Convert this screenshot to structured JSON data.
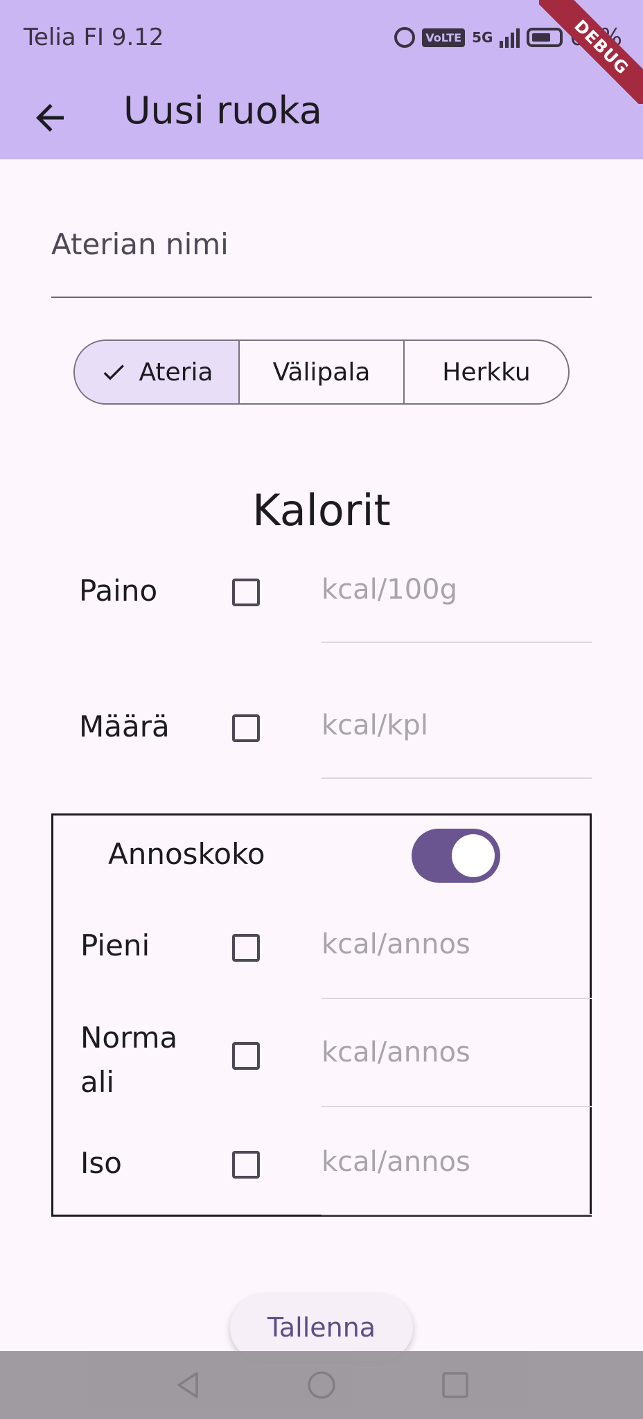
{
  "status_bar": {
    "carrier": "Telia FI",
    "time": "9.12",
    "volte": "VoLTE",
    "network": "5G",
    "battery_text": "60%",
    "icons": [
      "alarm-icon",
      "volte-icon",
      "signal-icon",
      "battery-icon"
    ]
  },
  "debug_banner": "DEBUG",
  "app_bar": {
    "title": "Uusi ruoka",
    "back_icon": "back-arrow-icon"
  },
  "form": {
    "name_placeholder": "Aterian nimi",
    "categories": [
      {
        "label": "Ateria",
        "selected": true
      },
      {
        "label": "Välipala",
        "selected": false
      },
      {
        "label": "Herkku",
        "selected": false
      }
    ],
    "section_title": "Kalorit",
    "weight": {
      "label": "Paino",
      "checked": false,
      "placeholder": "kcal/100g"
    },
    "count": {
      "label": "Määrä",
      "checked": false,
      "placeholder": "kcal/kpl"
    },
    "portion": {
      "label": "Annoskoko",
      "toggle_on": true,
      "sizes": [
        {
          "label": "Pieni",
          "checked": false,
          "placeholder": "kcal/annos"
        },
        {
          "label": "Norma\nali",
          "checked": false,
          "placeholder": "kcal/annos"
        },
        {
          "label": "Iso",
          "checked": false,
          "placeholder": "kcal/annos"
        }
      ]
    },
    "save_label": "Tallenna"
  },
  "colors": {
    "app_bar": "#c9b6f2",
    "background": "#fdf7fd",
    "accent": "#6a5590",
    "selected_segment": "#e8def8",
    "debug": "#a32a3f"
  }
}
